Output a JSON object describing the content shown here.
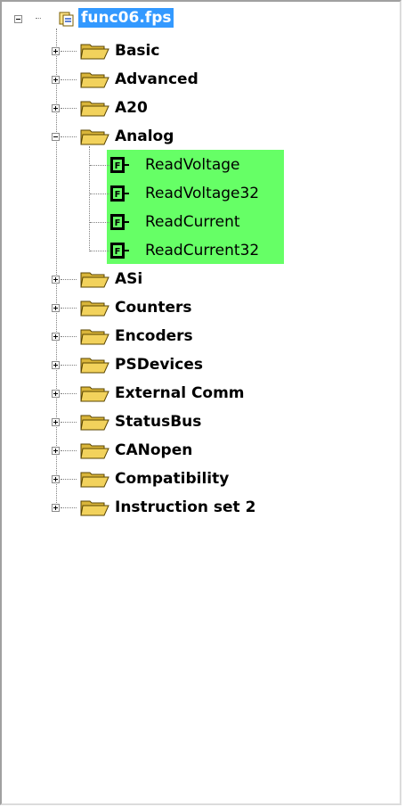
{
  "tree": {
    "root": {
      "label": "func06.fps",
      "icon": "document-stack-icon"
    },
    "folders_top": [
      {
        "label": "Basic"
      },
      {
        "label": "Advanced"
      },
      {
        "label": "A20"
      }
    ],
    "expanded_folder": {
      "label": "Analog",
      "functions": [
        {
          "label": "ReadVoltage",
          "icon": "function-icon",
          "badge": "F"
        },
        {
          "label": "ReadVoltage32",
          "icon": "function-icon",
          "badge": "F"
        },
        {
          "label": "ReadCurrent",
          "icon": "function-icon",
          "badge": "F"
        },
        {
          "label": "ReadCurrent32",
          "icon": "function-icon",
          "badge": "F"
        }
      ]
    },
    "folders_bottom": [
      {
        "label": "ASi"
      },
      {
        "label": "Counters"
      },
      {
        "label": "Encoders"
      },
      {
        "label": "PSDevices"
      },
      {
        "label": "External Comm"
      },
      {
        "label": "StatusBus"
      },
      {
        "label": "CANopen"
      },
      {
        "label": "Compatibility"
      },
      {
        "label": "Instruction set 2"
      }
    ]
  },
  "colors": {
    "selection": "#3399ff",
    "highlight": "#66ff66",
    "folder": "#f2d25c"
  }
}
